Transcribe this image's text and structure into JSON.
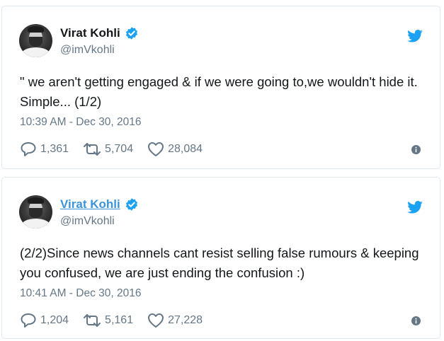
{
  "tweets": [
    {
      "name": "Virat Kohli",
      "handle": "@imVkohli",
      "text": "\" we aren't getting engaged & if we were going to,we wouldn't hide it. Simple... (1/2)",
      "timestamp": "10:39 AM - Dec 30, 2016",
      "replies": "1,361",
      "retweets": "5,704",
      "likes": "28,084"
    },
    {
      "name": "Virat Kohli",
      "handle": "@imVkohli",
      "text": "(2/2)Since news channels cant resist selling false rumours & keeping you confused, we are just ending the confusion :)",
      "timestamp": "10:41 AM - Dec 30, 2016",
      "replies": "1,204",
      "retweets": "5,161",
      "likes": "27,228"
    }
  ],
  "icons": {
    "verified": "verified-badge-icon",
    "twitter": "twitter-bird-icon",
    "reply": "reply-icon",
    "retweet": "retweet-icon",
    "like": "heart-icon",
    "info": "info-icon"
  },
  "colors": {
    "brand_blue": "#1da1f2",
    "link_blue": "#3b94d9",
    "muted_gray": "#657786",
    "text_dark": "#14171a"
  }
}
